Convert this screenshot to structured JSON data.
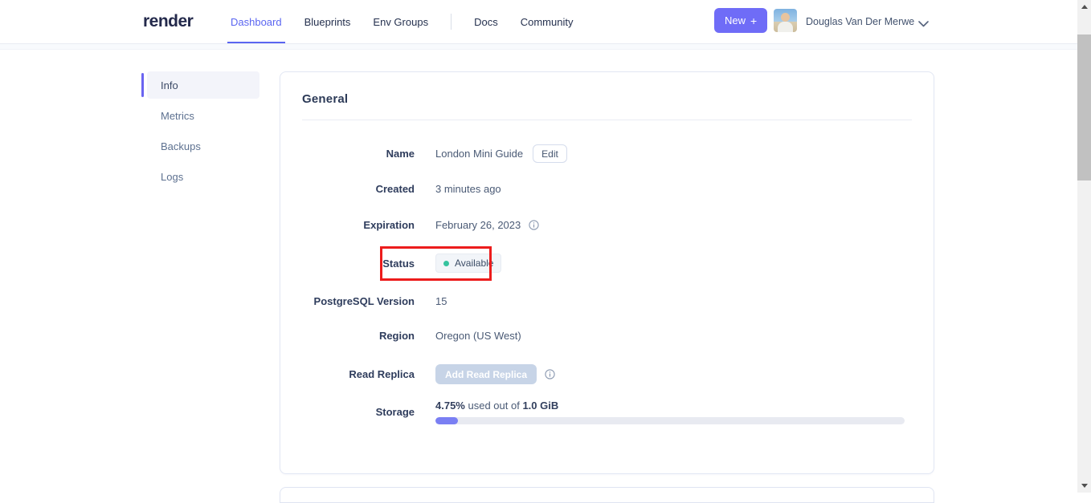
{
  "header": {
    "logo": "render",
    "nav": [
      {
        "label": "Dashboard",
        "active": true
      },
      {
        "label": "Blueprints",
        "active": false
      },
      {
        "label": "Env Groups",
        "active": false
      },
      {
        "label": "Docs",
        "active": false
      },
      {
        "label": "Community",
        "active": false
      }
    ],
    "new_button": {
      "label": "New",
      "plus": "+"
    },
    "user": {
      "name": "Douglas Van Der Merwe"
    }
  },
  "sidebar": {
    "items": [
      {
        "label": "Info",
        "active": true
      },
      {
        "label": "Metrics",
        "active": false
      },
      {
        "label": "Backups",
        "active": false
      },
      {
        "label": "Logs",
        "active": false
      }
    ]
  },
  "main": {
    "card_title": "General",
    "fields": {
      "name": {
        "label": "Name",
        "value": "London Mini Guide",
        "action": "Edit"
      },
      "created": {
        "label": "Created",
        "value": "3 minutes ago"
      },
      "expiration": {
        "label": "Expiration",
        "value": "February 26, 2023"
      },
      "status": {
        "label": "Status",
        "badge": "Available"
      },
      "version": {
        "label": "PostgreSQL Version",
        "value": "15"
      },
      "region": {
        "label": "Region",
        "value": "Oregon (US West)"
      },
      "read_replica": {
        "label": "Read Replica",
        "button": "Add Read Replica"
      },
      "storage": {
        "label": "Storage",
        "percent_used": "4.75%",
        "connector": " used out of ",
        "total": "1.0 GiB",
        "bar_percent": 4.75
      }
    }
  },
  "colors": {
    "accent": "#5a65f1",
    "new_button_bg": "#6f6cf7",
    "status_dot": "#35c39e",
    "annotation_red": "#ec1c1c",
    "progress_fill": "#7a7ff3"
  }
}
